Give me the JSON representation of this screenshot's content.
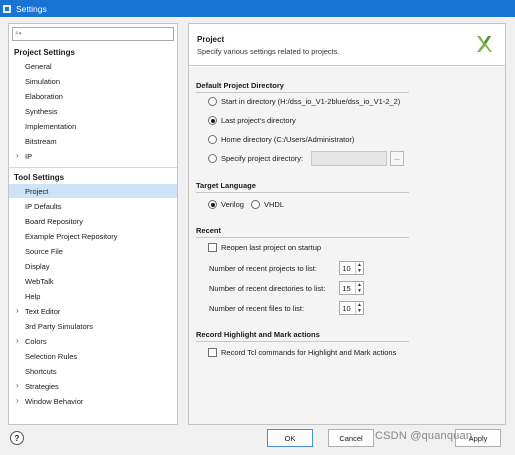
{
  "window": {
    "title": "Settings"
  },
  "search": {
    "placeholder": ""
  },
  "sidebar": {
    "project_settings": {
      "header": "Project Settings",
      "items": [
        {
          "label": "General"
        },
        {
          "label": "Simulation"
        },
        {
          "label": "Elaboration"
        },
        {
          "label": "Synthesis"
        },
        {
          "label": "Implementation"
        },
        {
          "label": "Bitstream"
        },
        {
          "label": "IP",
          "expandable": true
        }
      ]
    },
    "tool_settings": {
      "header": "Tool Settings",
      "items": [
        {
          "label": "Project",
          "selected": true
        },
        {
          "label": "IP Defaults"
        },
        {
          "label": "Board Repository"
        },
        {
          "label": "Example Project Repository"
        },
        {
          "label": "Source File"
        },
        {
          "label": "Display"
        },
        {
          "label": "WebTalk"
        },
        {
          "label": "Help"
        },
        {
          "label": "Text Editor",
          "expandable": true
        },
        {
          "label": "3rd Party Simulators"
        },
        {
          "label": "Colors",
          "expandable": true
        },
        {
          "label": "Selection Rules"
        },
        {
          "label": "Shortcuts"
        },
        {
          "label": "Strategies",
          "expandable": true
        },
        {
          "label": "Window Behavior",
          "expandable": true
        }
      ]
    }
  },
  "main": {
    "title": "Project",
    "subtitle": "Specify various settings related to projects.",
    "default_dir": {
      "title": "Default Project Directory",
      "options": [
        {
          "label": "Start in directory (H:/dss_io_V1-2blue/dss_io_V1-2_2)",
          "checked": false
        },
        {
          "label": "Last project's directory",
          "checked": true
        },
        {
          "label": "Home directory (C:/Users/Administrator)",
          "checked": false
        },
        {
          "label": "Specify project directory:",
          "checked": false
        }
      ],
      "specify_value": "",
      "browse_label": "..."
    },
    "target_language": {
      "title": "Target Language",
      "verilog": "Verilog",
      "vhdl": "VHDL",
      "selected": "Verilog"
    },
    "recent": {
      "title": "Recent",
      "reopen_label": "Reopen last project on startup",
      "reopen_checked": false,
      "spinners": [
        {
          "label": "Number of recent projects to list:",
          "value": "10"
        },
        {
          "label": "Number of recent directories to list:",
          "value": "15"
        },
        {
          "label": "Number of recent files to list:",
          "value": "10"
        }
      ]
    },
    "record": {
      "title": "Record Highlight and Mark actions",
      "label": "Record Tcl commands for Highlight and Mark actions",
      "checked": false
    }
  },
  "footer": {
    "help": "?",
    "ok": "OK",
    "cancel": "Cancel",
    "apply": "Apply",
    "watermark": "CSDN @quanquan"
  },
  "colors": {
    "titlebar": "#1873d3",
    "selection": "#cfe3f8",
    "logo": "#7ab648"
  }
}
